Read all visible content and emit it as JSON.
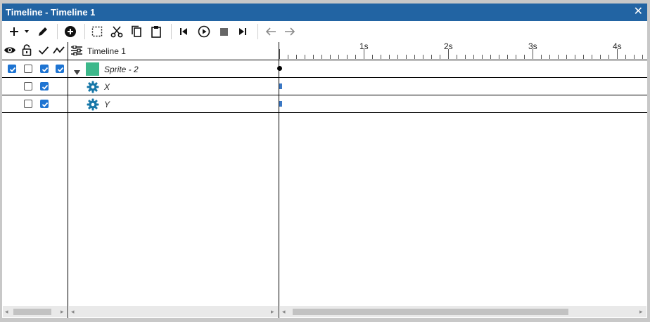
{
  "window": {
    "title": "Timeline - Timeline 1",
    "close_glyph": "✕"
  },
  "toolbar": {
    "buttons": [
      {
        "name": "add-icon"
      },
      {
        "name": "add-dropdown-icon"
      },
      {
        "name": "edit-icon"
      },
      {
        "name": "add-keyframe-icon"
      },
      {
        "name": "select-region-icon"
      },
      {
        "name": "cut-icon"
      },
      {
        "name": "copy-icon"
      },
      {
        "name": "paste-icon"
      },
      {
        "name": "skip-to-start-icon"
      },
      {
        "name": "play-icon"
      },
      {
        "name": "stop-icon"
      },
      {
        "name": "skip-to-end-icon"
      },
      {
        "name": "undo-arrow-icon"
      },
      {
        "name": "redo-arrow-icon"
      }
    ]
  },
  "header": {
    "visibility_icon": "eye-icon",
    "lock_icon": "unlock-icon",
    "enabled_icon": "check-icon",
    "curve_icon": "curve-icon",
    "timeline_icon": "timeline-icon",
    "timeline_name": "Timeline 1"
  },
  "tracks": [
    {
      "label": "Sprite - 2",
      "visible": true,
      "locked": false,
      "enabled": true,
      "curve": true,
      "color": "#3cb88a",
      "expanded": true
    },
    {
      "label": "X",
      "locked": false,
      "enabled": true,
      "icon": "gear-icon"
    },
    {
      "label": "Y",
      "locked": false,
      "enabled": true,
      "icon": "gear-icon"
    }
  ],
  "ruler": {
    "labels": [
      "1s",
      "2s",
      "3s",
      "4s"
    ]
  },
  "colors": {
    "accent": "#2264a3",
    "checkbox": "#1e74d2",
    "gear": "#1677a8",
    "keyframe": "#3b78c4"
  }
}
